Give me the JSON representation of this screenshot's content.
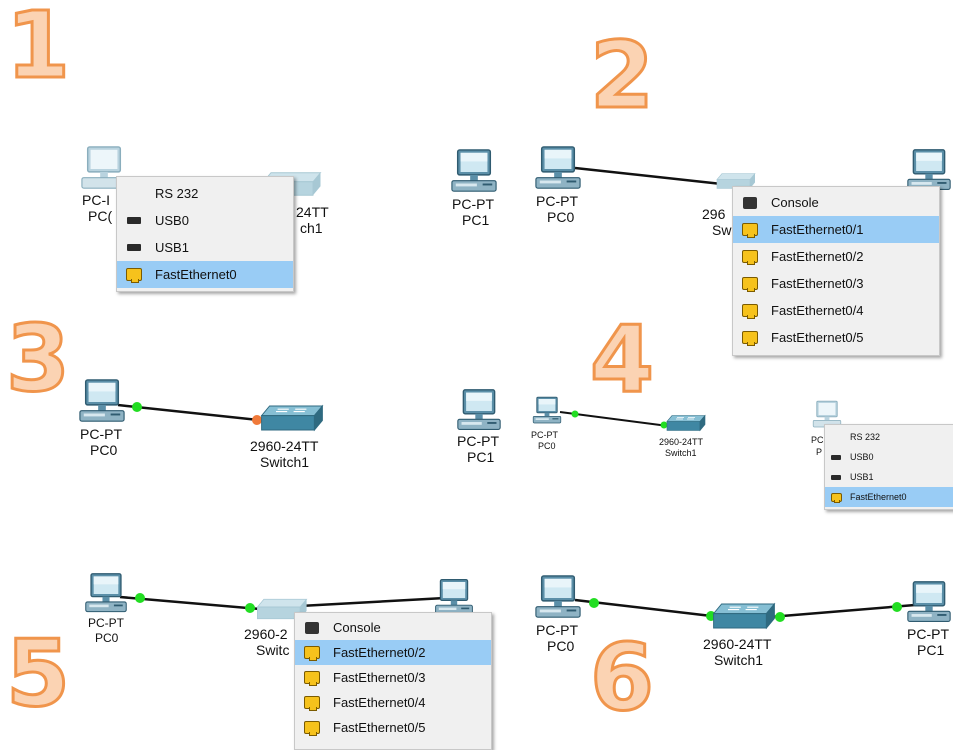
{
  "steps": [
    "1",
    "2",
    "3",
    "4",
    "5",
    "6"
  ],
  "devices": {
    "pc_type": "PC-PT",
    "pc0": "PC0",
    "pc1": "PC1",
    "switch_model": "2960-24TT",
    "switch1": "Switch1",
    "pc_type_cut": "PC-I",
    "pc0_cut": "PC(",
    "switch_model_cut1": "24TT",
    "switch1_cut1": "ch1",
    "switch_model_cut2": "296",
    "switch1_cut2": "Sw",
    "switch_model_cut5": "2960-2",
    "switch1_cut5": "Switc",
    "pc_type_cut4": "PC",
    "pc0_cut4": "P",
    "pc_type_cut6": "PC-PT"
  },
  "menus": {
    "pc_ports": [
      "RS 232",
      "USB0",
      "USB1",
      "FastEthernet0"
    ],
    "switch_ports_2": [
      "Console",
      "FastEthernet0/1",
      "FastEthernet0/2",
      "FastEthernet0/3",
      "FastEthernet0/4",
      "FastEthernet0/5"
    ],
    "switch_ports_5": [
      "Console",
      "FastEthernet0/2",
      "FastEthernet0/3",
      "FastEthernet0/4",
      "FastEthernet0/5"
    ]
  },
  "icons": {
    "pc": "pc-icon",
    "switch": "switch-icon",
    "ethernet_port": "ethernet-port-icon",
    "usb_port": "usb-port-icon",
    "console_port": "console-port-icon"
  },
  "colors": {
    "step_fill": "#fbd3b3",
    "step_stroke": "#f0954c",
    "link_up": "#22dd22",
    "link_pending": "#f07a3a",
    "menu_selected": "#99ccf5",
    "ethernet_port": "#f6c21c"
  },
  "selected": {
    "menu1": "FastEthernet0",
    "menu2": "FastEthernet0/1",
    "menu4": "FastEthernet0",
    "menu5": "FastEthernet0/2"
  }
}
